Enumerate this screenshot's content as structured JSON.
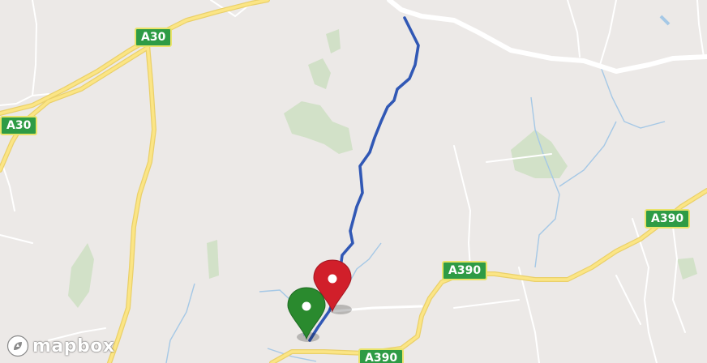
{
  "map": {
    "attribution": "mapbox",
    "road_labels": [
      "A30",
      "A30",
      "A390",
      "A390",
      "A390"
    ]
  },
  "markers": [
    {
      "role": "start",
      "color": "#2a8a2e",
      "icon": "map-pin-icon"
    },
    {
      "role": "end",
      "color": "#d11f2a",
      "icon": "map-pin-icon"
    }
  ],
  "route": {
    "color": "#3158b5"
  },
  "colors": {
    "land": "#ece9e7",
    "major_road": "#f2d36b",
    "road_shield": "#2e9b45",
    "water": "#a5c8e6",
    "park": "#cfe4c5"
  }
}
